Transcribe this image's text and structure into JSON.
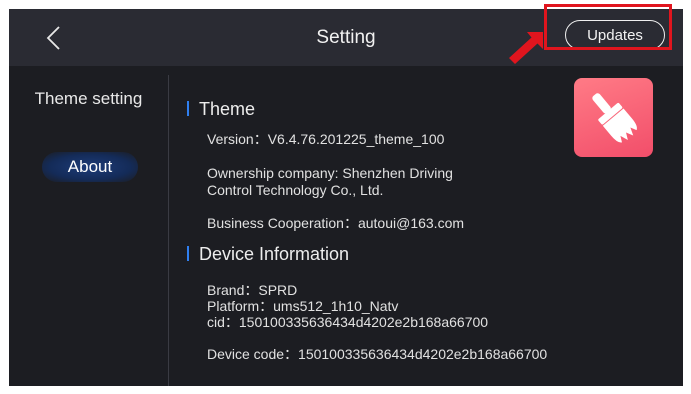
{
  "header": {
    "title": "Setting",
    "back_icon": "chevron-left-icon",
    "updates_label": "Updates"
  },
  "sidebar": {
    "items": [
      {
        "label": "Theme setting",
        "active": false
      },
      {
        "label": "About",
        "active": true
      }
    ]
  },
  "theme": {
    "title": "Theme",
    "version": "Version：V6.4.76.201225_theme_100",
    "ownership_line1": "Ownership company: Shenzhen Driving",
    "ownership_line2": "Control Technology Co., Ltd.",
    "business": "Business Cooperation：autoui@163.com",
    "icon": "paintbrush-icon"
  },
  "device": {
    "title": "Device Information",
    "brand": "Brand：SPRD",
    "platform": "Platform：ums512_1h10_Natv",
    "cid": "cid：150100335636434d4202e2b168a66700",
    "device_code": "Device code：150100335636434d4202e2b168a66700"
  },
  "colors": {
    "accent": "#2f7ff0",
    "highlight": "#e0151e",
    "background": "#1c1d22"
  }
}
